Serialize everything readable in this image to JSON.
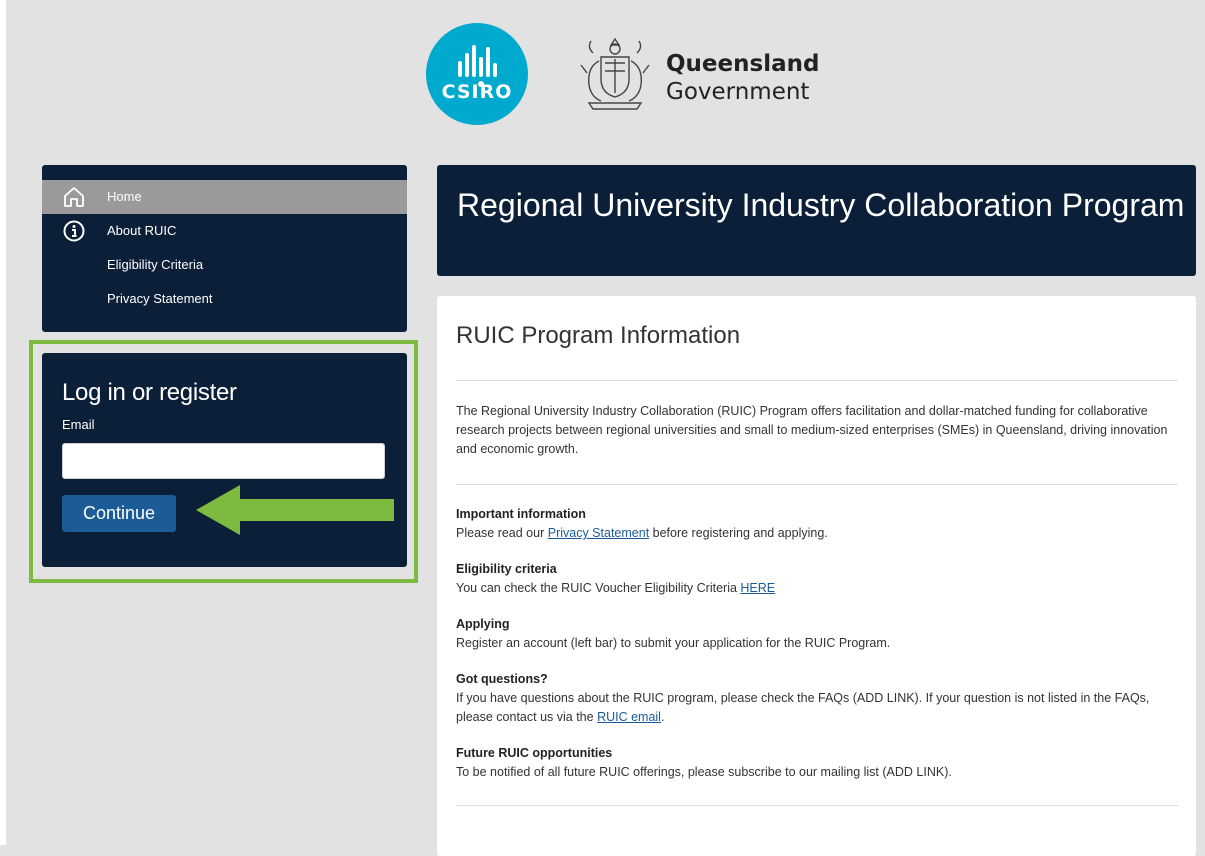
{
  "header": {
    "csiro_logo": "CSIRO",
    "gov_title_line1": "Queensland",
    "gov_title_line2": "Government"
  },
  "sidebar": {
    "items": [
      {
        "label": "Home",
        "icon": "home-icon",
        "active": true
      },
      {
        "label": "About RUIC",
        "icon": "info-icon",
        "active": false
      },
      {
        "label": "Eligibility Criteria",
        "icon": "",
        "active": false
      },
      {
        "label": "Privacy Statement",
        "icon": "",
        "active": false
      }
    ]
  },
  "login": {
    "title": "Log in or register",
    "email_label": "Email",
    "email_value": "",
    "email_placeholder": "",
    "continue_label": "Continue"
  },
  "hero": {
    "title": "Regional University Industry Collaboration Program"
  },
  "content": {
    "title": "RUIC Program Information",
    "intro": "The Regional University Industry Collaboration (RUIC) Program offers facilitation and dollar-matched funding for collaborative research projects between regional universities and small to medium-sized enterprises (SMEs) in Queensland, driving innovation and economic growth.",
    "important": {
      "heading": "Important information",
      "before": "Please read our ",
      "link": "Privacy Statement",
      "after": " before registering and applying."
    },
    "eligibility": {
      "heading": "Eligibility criteria",
      "before": "You can check the RUIC Voucher Eligibility Criteria ",
      "link": "HERE"
    },
    "applying": {
      "heading": "Applying",
      "text": "Register an account (left bar) to submit your application for the RUIC Program."
    },
    "questions": {
      "heading": "Got questions?",
      "before": "If you have questions about the RUIC program, please check the FAQs (ADD LINK). If your question is not listed in the FAQs, please contact us via the ",
      "link": "RUIC email",
      "after": "."
    },
    "future": {
      "heading": "Future RUIC opportunities",
      "text": "To be notified of all future RUIC offerings, please subscribe to our mailing list (ADD LINK)."
    }
  },
  "colors": {
    "navy": "#0b1f38",
    "csiro_blue": "#00a9ce",
    "button_blue": "#1b5c97",
    "highlight_green": "#7cbb40"
  }
}
